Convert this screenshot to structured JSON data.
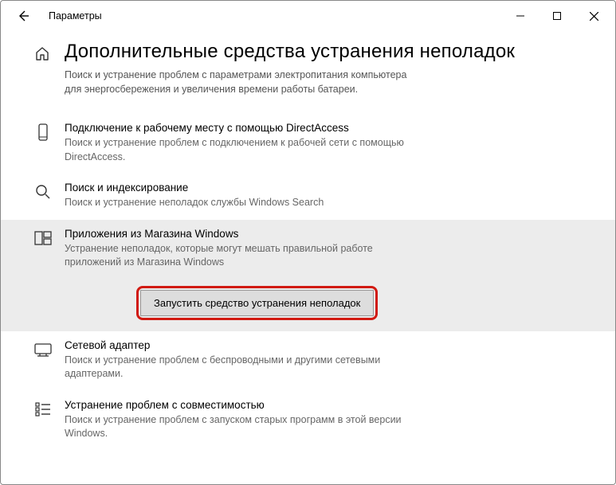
{
  "window": {
    "title": "Параметры"
  },
  "page": {
    "title": "Дополнительные средства устранения неполадок",
    "description": "Поиск и устранение проблем с параметрами электропитания компьютера для энергосбережения и увеличения  времени работы батареи."
  },
  "items": {
    "directaccess": {
      "title": "Подключение к рабочему месту с помощью DirectAccess",
      "desc": "Поиск и устранение проблем с подключением к рабочей сети с помощью DirectAccess."
    },
    "search": {
      "title": "Поиск и индексирование",
      "desc": "Поиск и устранение неполадок службы Windows Search"
    },
    "store": {
      "title": "Приложения из Магазина Windows",
      "desc": "Устранение неполадок, которые могут мешать правильной работе приложений из Магазина Windows"
    },
    "network": {
      "title": "Сетевой адаптер",
      "desc": "Поиск и устранение проблем с беспроводными и другими сетевыми адаптерами."
    },
    "compat": {
      "title": "Устранение проблем с совместимостью",
      "desc": "Поиск и устранение проблем с запуском старых программ в этой версии Windows."
    }
  },
  "actions": {
    "run_troubleshooter": "Запустить средство устранения неполадок"
  }
}
